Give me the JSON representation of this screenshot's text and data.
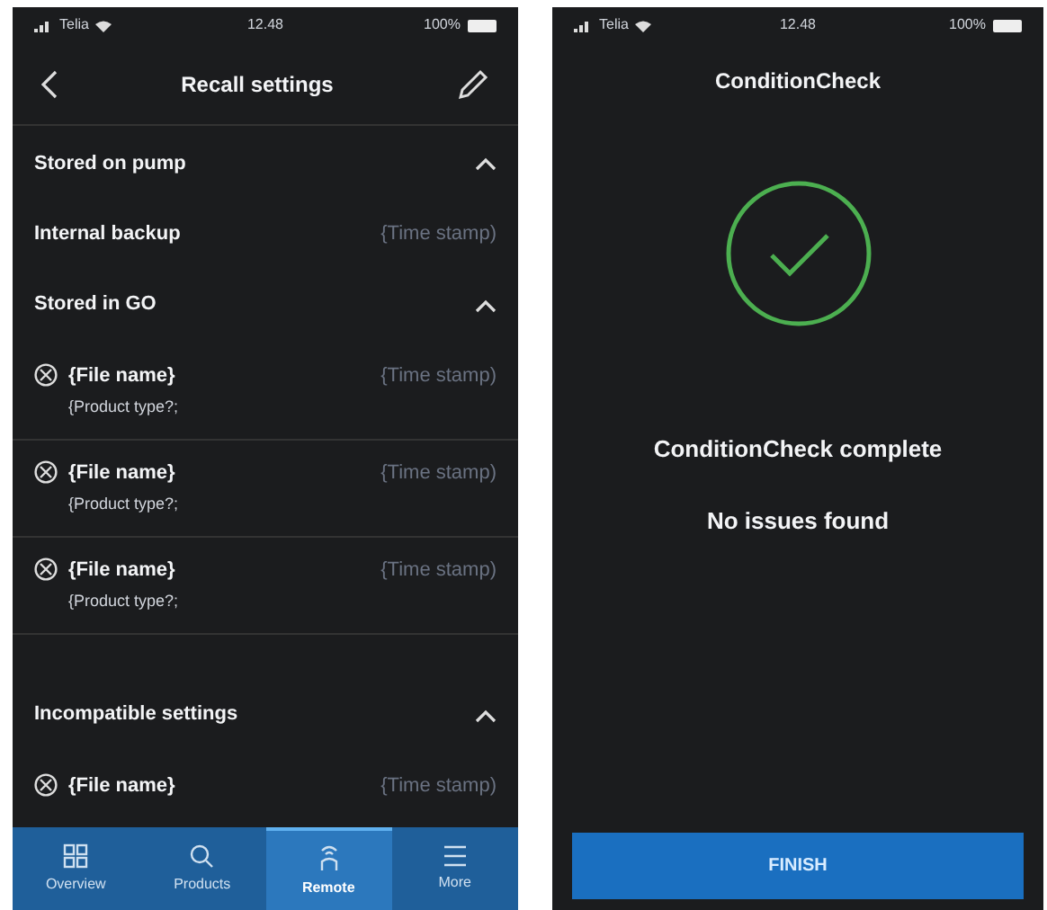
{
  "recall_screen": {
    "status_bar": {
      "carrier": "Telia",
      "time": "12.48",
      "battery": "100%"
    },
    "title": "Recall settings",
    "sections": [
      {
        "title": "Stored on pump",
        "expanded": true,
        "items": [
          {
            "kind": "plain",
            "name": "Internal backup",
            "time": "{Time stamp)"
          }
        ]
      },
      {
        "title": "Stored in GO",
        "expanded": true,
        "items": [
          {
            "kind": "file",
            "name": "{File name}",
            "subtitle": "{Product type?;",
            "time": "{Time stamp)"
          },
          {
            "kind": "file",
            "name": "{File name}",
            "subtitle": "{Product type?;",
            "time": "{Time stamp)"
          },
          {
            "kind": "file",
            "name": "{File name}",
            "subtitle": "{Product type?;",
            "time": "{Time stamp)"
          }
        ]
      },
      {
        "title": "Incompatible settings",
        "expanded": true,
        "items": [
          {
            "kind": "file",
            "name": "{File name}",
            "time": "{Time stamp)"
          }
        ]
      }
    ],
    "nav": [
      {
        "label": "Overview",
        "selected": false
      },
      {
        "label": "Products",
        "selected": false
      },
      {
        "label": "Remote",
        "selected": true
      },
      {
        "label": "More",
        "selected": false
      }
    ]
  },
  "condition_screen": {
    "status_bar": {
      "carrier": "Telia",
      "time": "12.48",
      "battery": "100%"
    },
    "title": "ConditionCheck",
    "heading": "ConditionCheck complete",
    "message": "No issues found",
    "button": "FINISH"
  }
}
